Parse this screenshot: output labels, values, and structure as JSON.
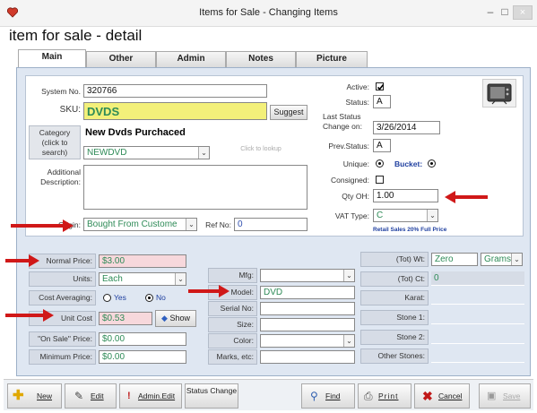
{
  "window": {
    "title": "Items for Sale - Changing Items",
    "controls": [
      "–",
      "□",
      "×"
    ]
  },
  "page_title": "item for sale - detail",
  "tabs": [
    "Main",
    "Other",
    "Admin",
    "Notes",
    "Picture"
  ],
  "top": {
    "system_no_label": "System No.",
    "system_no": "320766",
    "sku_label": "SKU:",
    "sku": "DVDS",
    "suggest": "Suggest",
    "category_label": "Category (click to search)",
    "category_name": "New Dvds Purchaced",
    "category_code": "NEWDVD",
    "click_to_lookup": "Click to lookup",
    "additional_label": "Additional Description:",
    "origin_label": "Origin:",
    "origin": "Bought From Custome",
    "ref_no_label": "Ref No:",
    "ref_no": "0"
  },
  "status": {
    "active_label": "Active:",
    "status_label": "Status:",
    "status": "A",
    "last_status_label": "Last Status Change on:",
    "last_status_date": "3/26/2014",
    "prev_status_label": "Prev.Status:",
    "prev_status": "A",
    "unique_label": "Unique:",
    "bucket_label": "Bucket:",
    "consigned_label": "Consigned:",
    "qty_label": "Qty OH:",
    "qty": "1.00",
    "vat_label": "VAT Type:",
    "vat": "C",
    "vat_note": "Retail Sales 20% Full Price"
  },
  "pricing": {
    "normal_price_label": "Normal Price:",
    "normal_price": "$3.00",
    "units_label": "Units:",
    "units": "Each",
    "cost_avg_label": "Cost Averaging:",
    "yes": "Yes",
    "no": "No",
    "unit_cost_label": "Unit Cost",
    "unit_cost": "$0.53",
    "show": "Show",
    "on_sale_label": "\"On Sale\" Price:",
    "on_sale": "$0.00",
    "min_price_label": "Minimum Price:",
    "min_price": "$0.00"
  },
  "details": {
    "mfg_label": "Mfg:",
    "model_label": "Model:",
    "model": "DVD",
    "serial_label": "Serial No:",
    "size_label": "Size:",
    "color_label": "Color:",
    "marks_label": "Marks, etc:"
  },
  "gems": {
    "tot_wt_label": "(Tot) Wt:",
    "tot_wt": "Zero",
    "wt_unit": "Grams",
    "tot_ct_label": "(Tot) Ct:",
    "tot_ct": "0",
    "karat_label": "Karat:",
    "stone1_label": "Stone 1:",
    "stone2_label": "Stone 2:",
    "other_label": "Other Stones:"
  },
  "toolbar": {
    "new": "New",
    "edit": "Edit",
    "admin_edit": "Admin.Edit",
    "status_change": "Status Change",
    "find": "Find",
    "print": "Print",
    "cancel": "Cancel",
    "save": "Save"
  },
  "colors": {
    "accent_arrow": "#d01818",
    "panel": "#dfe7f2",
    "sku_bg": "#f3f07a",
    "price_bg": "#f7d8dc"
  }
}
